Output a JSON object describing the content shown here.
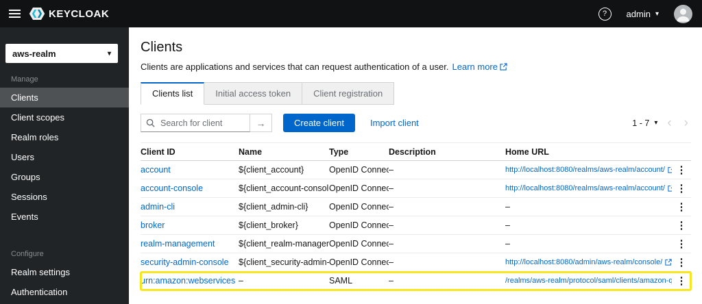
{
  "colors": {
    "accent_blue": "#0066cc",
    "masthead_bg": "#101214",
    "sidebar_bg": "#212427",
    "active_nav_bg": "#4f5255",
    "highlight_yellow": "#f9e71e"
  },
  "icons": {
    "caret_down": "▾",
    "chevron_left": "‹",
    "chevron_right": "›",
    "kebab": "⋮",
    "arrow_right": "→",
    "help": "?"
  },
  "masthead": {
    "brand": "KEYCLOAK",
    "username": "admin"
  },
  "sidebar": {
    "realm": "aws-realm",
    "sections": [
      {
        "label": "Manage",
        "items": [
          {
            "label": "Clients",
            "active": true
          },
          {
            "label": "Client scopes"
          },
          {
            "label": "Realm roles"
          },
          {
            "label": "Users"
          },
          {
            "label": "Groups"
          },
          {
            "label": "Sessions"
          },
          {
            "label": "Events"
          }
        ]
      },
      {
        "label": "Configure",
        "items": [
          {
            "label": "Realm settings"
          },
          {
            "label": "Authentication"
          }
        ]
      }
    ]
  },
  "main": {
    "title": "Clients",
    "subtitle": "Clients are applications and services that can request authentication of a user.",
    "learn_more_label": "Learn more",
    "tabs": [
      {
        "label": "Clients list",
        "active": true
      },
      {
        "label": "Initial access token",
        "active": false
      },
      {
        "label": "Client registration",
        "active": false
      }
    ],
    "toolbar": {
      "search_placeholder": "Search for client",
      "create_button_label": "Create client",
      "import_link_label": "Import client",
      "pagination_label": "1 - 7"
    },
    "table": {
      "columns": [
        "Client ID",
        "Name",
        "Type",
        "Description",
        "Home URL"
      ],
      "rows": [
        {
          "client_id": "account",
          "name": "${client_account}",
          "type": "OpenID Connect",
          "description": "–",
          "home_url": "http://localhost:8080/realms/aws-realm/account/"
        },
        {
          "client_id": "account-console",
          "name": "${client_account-console}",
          "type": "OpenID Connect",
          "description": "–",
          "home_url": "http://localhost:8080/realms/aws-realm/account/"
        },
        {
          "client_id": "admin-cli",
          "name": "${client_admin-cli}",
          "type": "OpenID Connect",
          "description": "–",
          "home_url": "–"
        },
        {
          "client_id": "broker",
          "name": "${client_broker}",
          "type": "OpenID Connect",
          "description": "–",
          "home_url": "–"
        },
        {
          "client_id": "realm-management",
          "name": "${client_realm-managem…",
          "type": "OpenID Connect",
          "description": "–",
          "home_url": "–"
        },
        {
          "client_id": "security-admin-console",
          "name": "${client_security-admin-…",
          "type": "OpenID Connect",
          "description": "–",
          "home_url": "http://localhost:8080/admin/aws-realm/console/"
        },
        {
          "client_id": "urn:amazon:webservices",
          "name": "–",
          "type": "SAML",
          "description": "–",
          "home_url": "/realms/aws-realm/protocol/saml/clients/amazon-qs",
          "highlighted": true
        }
      ]
    }
  }
}
